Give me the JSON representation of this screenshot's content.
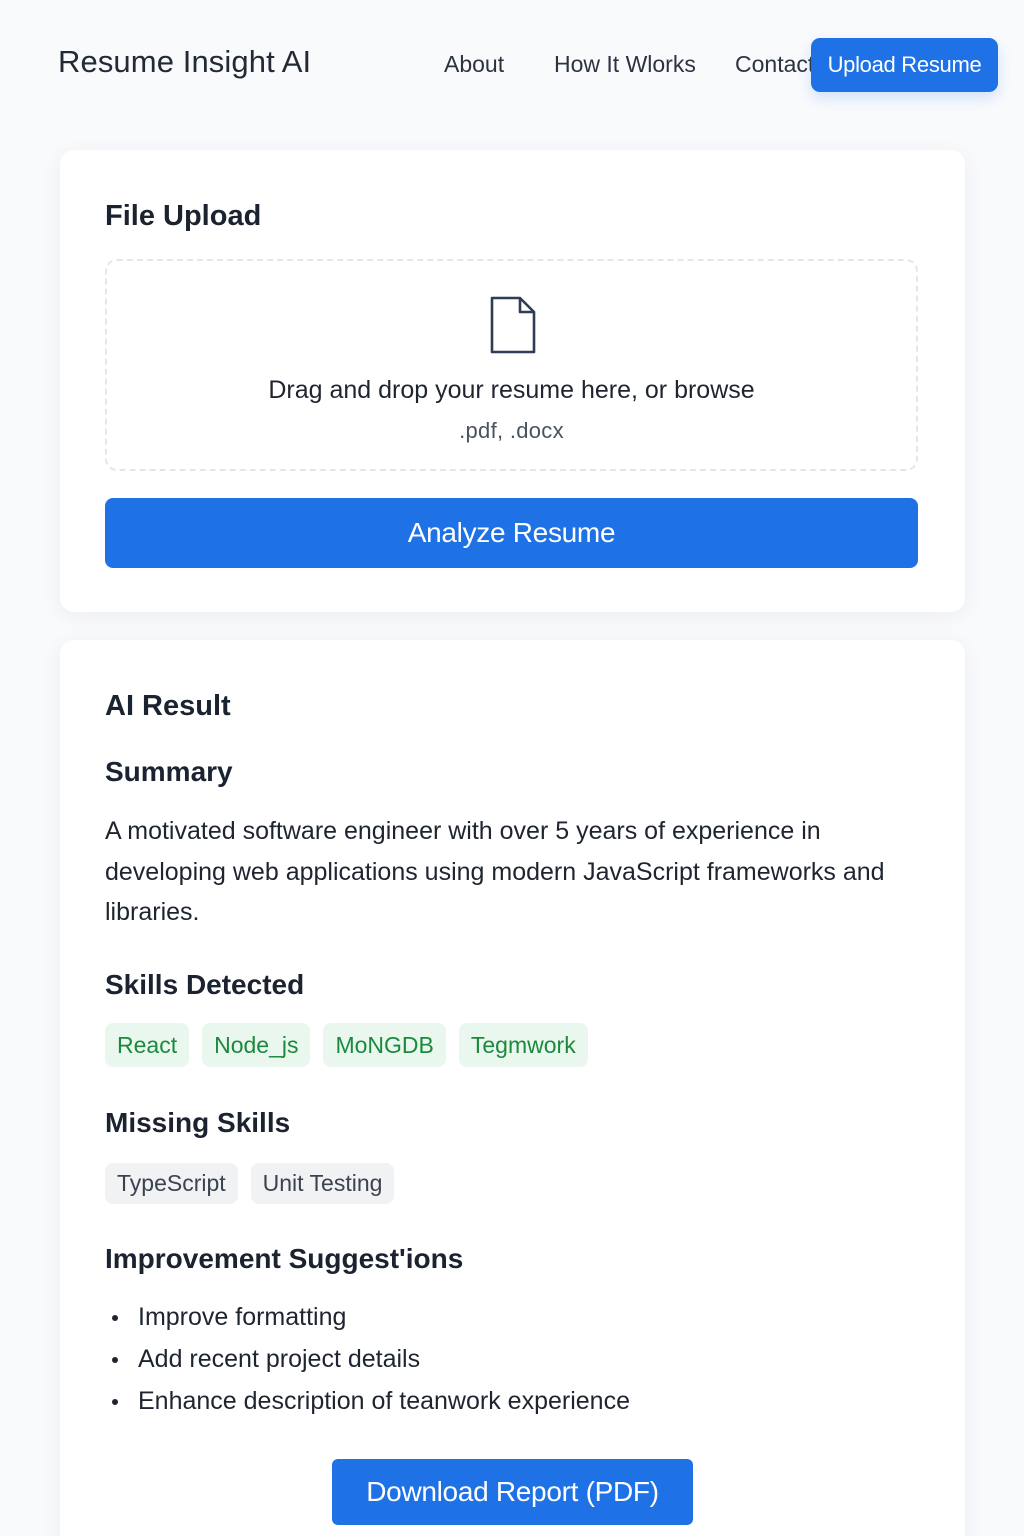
{
  "nav": {
    "brand": "Resume Insight AI",
    "links": [
      "About",
      "How It Wlorks",
      "Contact"
    ],
    "upload_label": "Upload Resume"
  },
  "upload": {
    "title": "File Upload",
    "icon": "file-icon",
    "drop_text": "Drag and drop your resume here, or browse",
    "file_types": ".pdf,  .docx",
    "analyze_label": "Analyze Resume"
  },
  "result": {
    "title": "AI Result",
    "summary_heading": "Summary",
    "summary_text": "A motivated software engineer with over 5 years of experience in developing web applications using modern JavaScript frameworks and libraries.",
    "skills_heading": "Skills Detected",
    "skills": [
      "React",
      "Node_js",
      "MoNGDB",
      "Tegmwork"
    ],
    "missing_heading": "Missing Skills",
    "missing": [
      "TypeScript",
      "Unit Testing"
    ],
    "improve_heading": "Improvement Suggest'ions",
    "suggestions": [
      "Improve formatting",
      "Add recent project details",
      "Enhance description of teanwork experience"
    ],
    "download_label": "Download Report (PDF)"
  },
  "colors": {
    "accent": "#1e72e6",
    "skill_chip_bg": "#e9f7ee",
    "skill_chip_text": "#1c8a3c",
    "missing_chip_bg": "#f1f2f4"
  }
}
